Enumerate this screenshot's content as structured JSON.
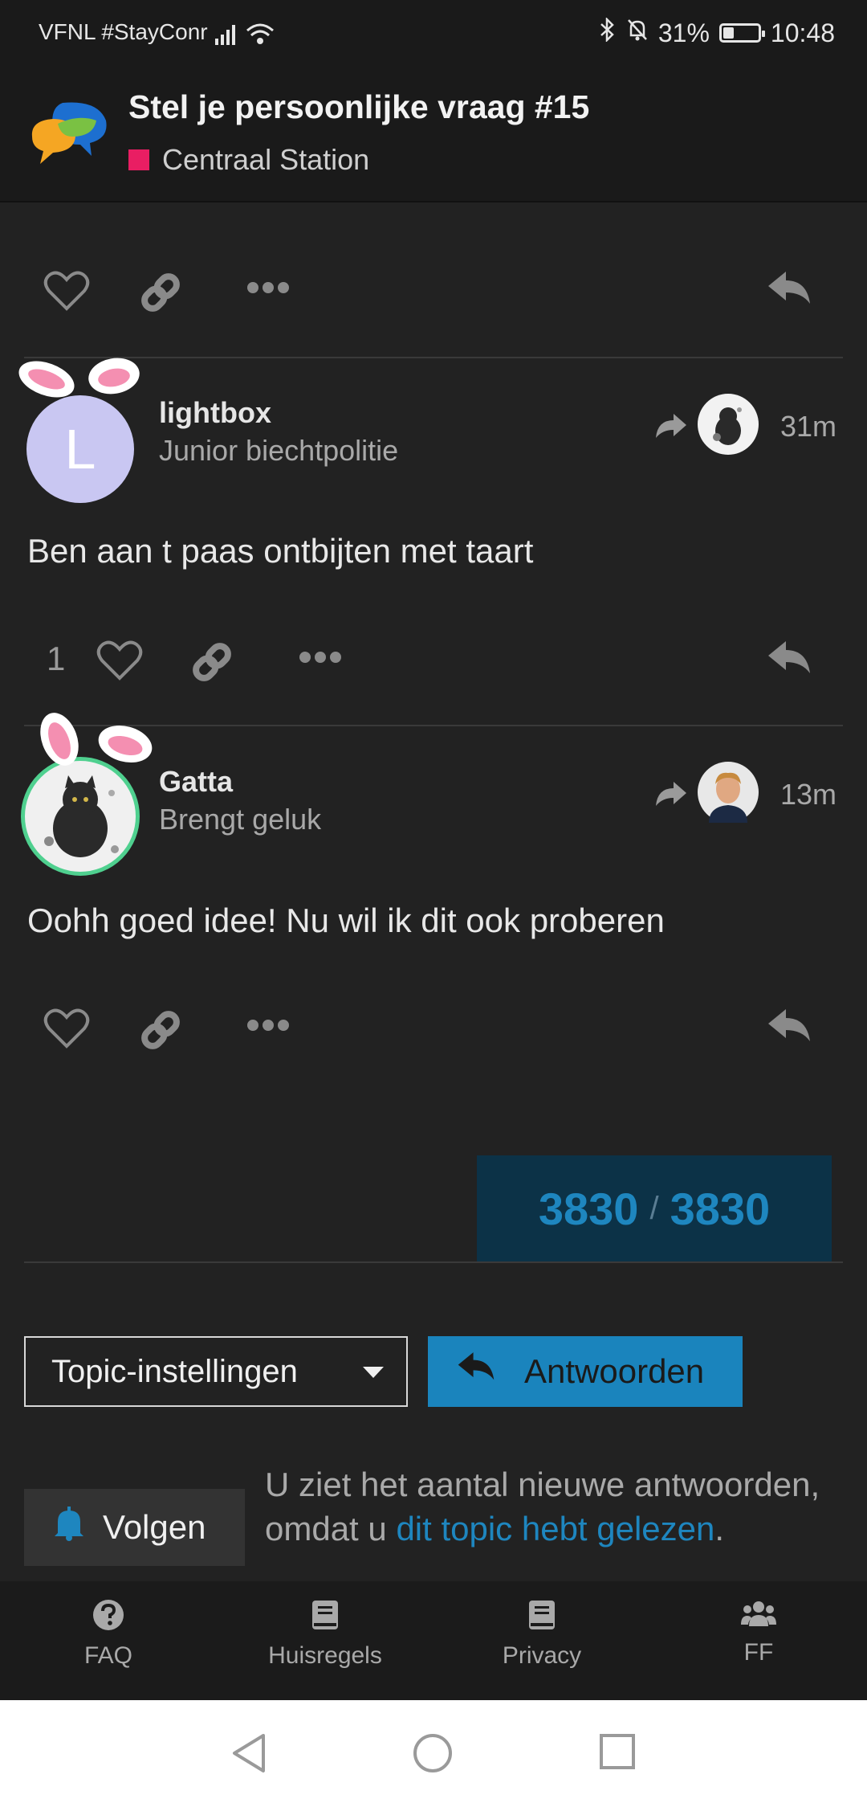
{
  "status_bar": {
    "carrier": "VFNL #StayConr",
    "battery": "31%",
    "battery_level": 0.31,
    "time": "10:48"
  },
  "header": {
    "title": "Stel je persoonlijke vraag #15",
    "category": "Centraal Station",
    "category_color": "#e91e63"
  },
  "posts": [
    {
      "avatar_letter": "L",
      "username": "lightbox",
      "user_title": "Junior biechtpolitie",
      "time": "31m",
      "body": "Ben aan t paas ontbijten met taart",
      "like_count": "1"
    },
    {
      "username": "Gatta",
      "user_title": "Brengt geluk",
      "time": "13m",
      "body": "Oohh goed idee! Nu wil ik dit ook proberen"
    }
  ],
  "progress": {
    "current": "3830",
    "separator": "/",
    "total": "3830"
  },
  "controls": {
    "topic_settings": "Topic-instellingen",
    "reply": "Antwoorden",
    "follow": "Volgen",
    "notice_text": "U ziet het aantal nieuwe antwoorden, omdat u ",
    "notice_link": "dit topic hebt gelezen",
    "notice_end": "."
  },
  "footer": {
    "items": [
      {
        "label": "FAQ",
        "icon": "question-circle-icon"
      },
      {
        "label": "Huisregels",
        "icon": "book-icon"
      },
      {
        "label": "Privacy",
        "icon": "book-icon"
      },
      {
        "label": "FF",
        "icon": "users-icon"
      }
    ]
  },
  "colors": {
    "accent": "#1a84bd",
    "background": "#222222"
  }
}
